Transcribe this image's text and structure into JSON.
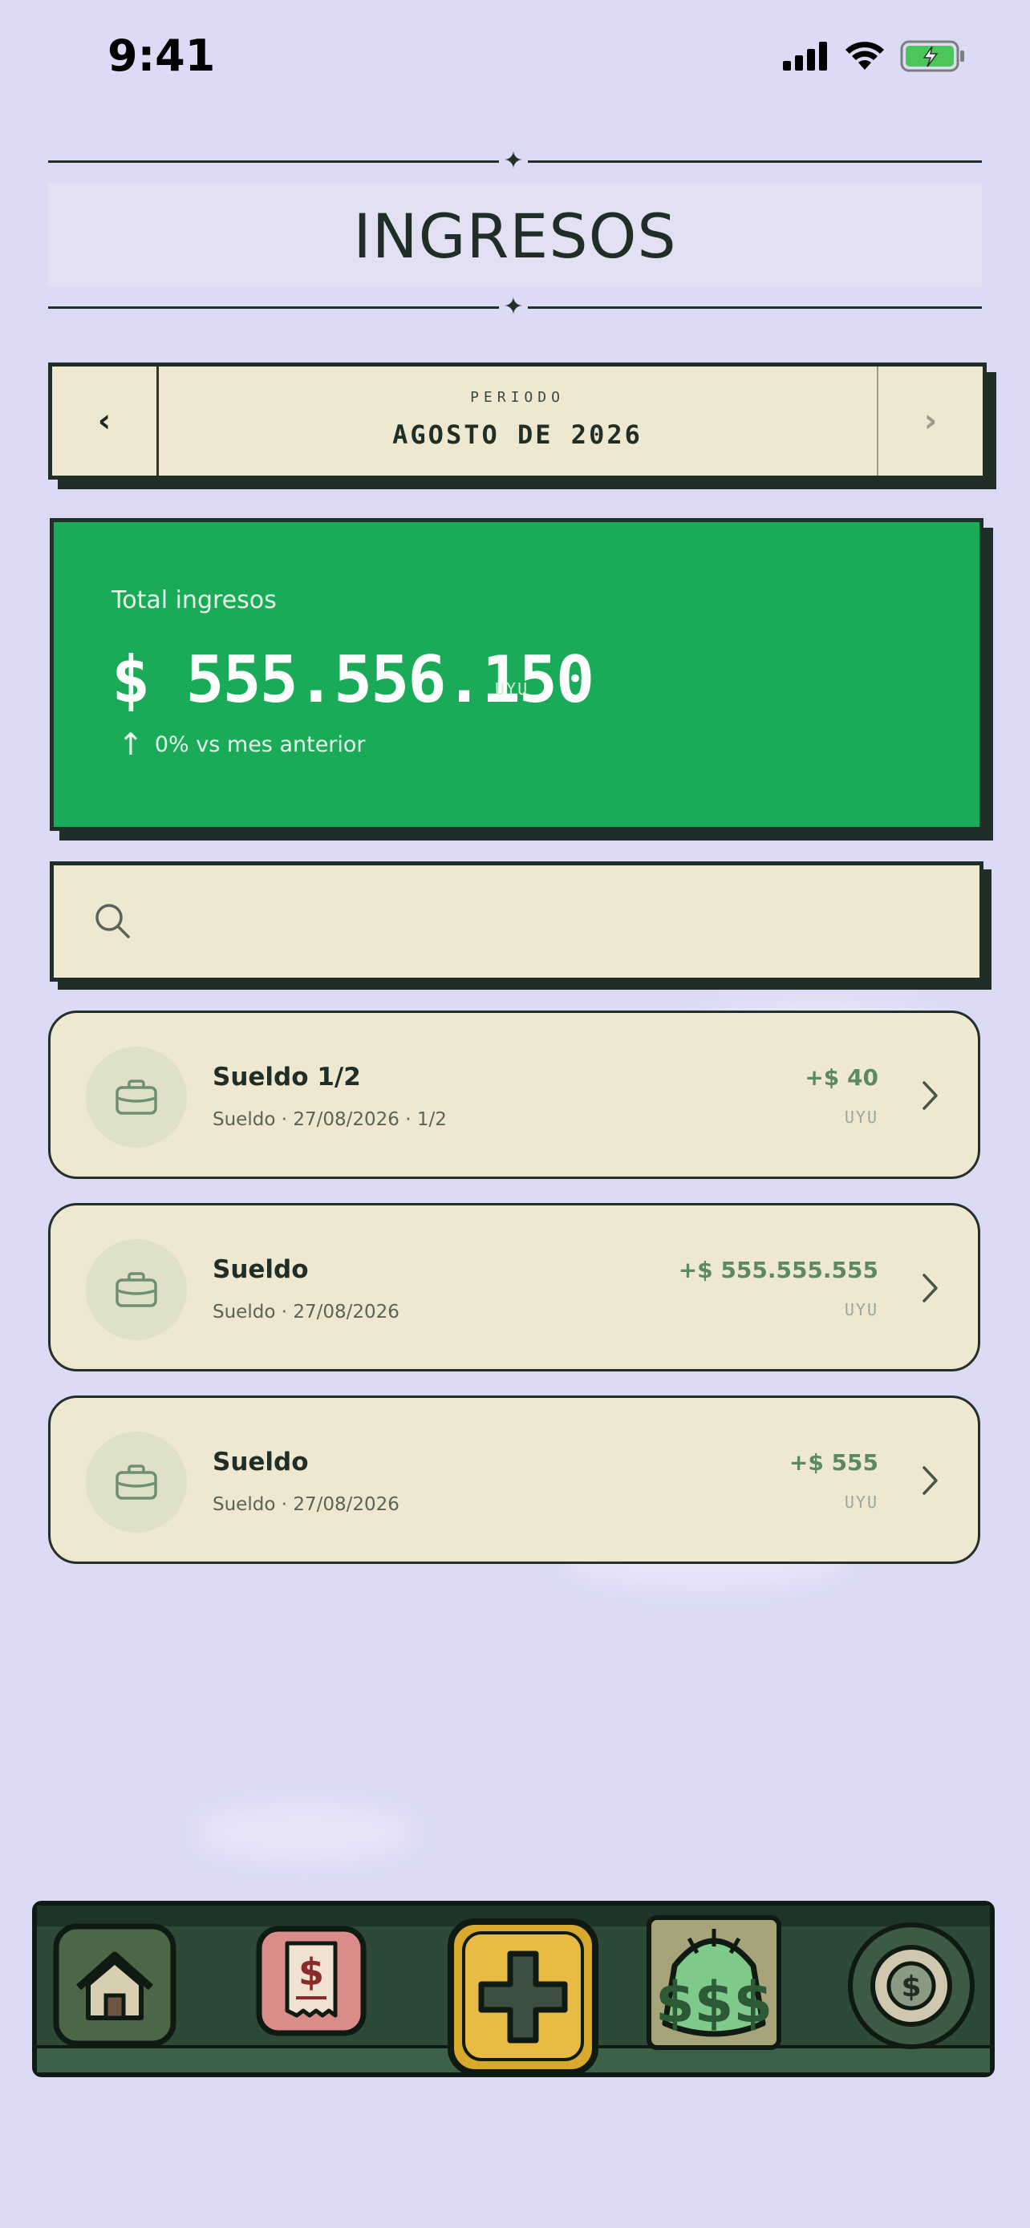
{
  "status_bar": {
    "time": "9:41"
  },
  "header": {
    "title": "INGRESOS",
    "ornament": "✦"
  },
  "period": {
    "label": "PERIODO",
    "value": "AGOSTO DE 2026",
    "prev": "‹",
    "next": "›"
  },
  "total": {
    "label": "Total ingresos",
    "amount": "$ 555.556.150",
    "currency": "UYU",
    "change": "0% vs mes anterior",
    "arrow": "↑"
  },
  "search": {
    "placeholder": "",
    "value": "",
    "icon": "search-icon"
  },
  "incomes": [
    {
      "title": "Sueldo 1/2",
      "subtitle": "Sueldo · 27/08/2026 · 1/2",
      "amount": "+$ 40",
      "currency": "UYU",
      "icon": "briefcase-icon"
    },
    {
      "title": "Sueldo",
      "subtitle": "Sueldo · 27/08/2026",
      "amount": "+$ 555.555.555",
      "currency": "UYU",
      "icon": "briefcase-icon"
    },
    {
      "title": "Sueldo",
      "subtitle": "Sueldo · 27/08/2026",
      "amount": "+$ 555",
      "currency": "UYU",
      "icon": "briefcase-icon"
    }
  ],
  "tabbar": {
    "tabs": [
      {
        "id": "home",
        "icon": "house-icon"
      },
      {
        "id": "expenses",
        "icon": "receipt-icon"
      },
      {
        "id": "add",
        "icon": "plus-icon"
      },
      {
        "id": "incomes",
        "icon": "money-bag-icon",
        "active": true
      },
      {
        "id": "savings",
        "icon": "coin-icon"
      }
    ]
  },
  "colors": {
    "background": "#dcdaf5",
    "card": "#efe8d1",
    "accent_green": "#1aab58",
    "dark": "#1f2e27",
    "amount_green": "#5b8a61"
  }
}
